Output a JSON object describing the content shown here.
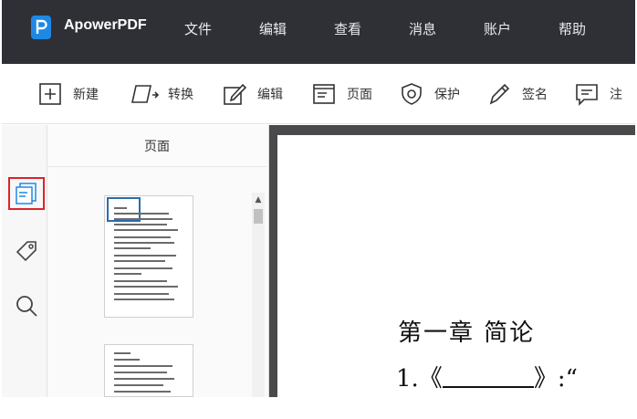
{
  "app": {
    "name": "ApowerPDF"
  },
  "menu": [
    "文件",
    "编辑",
    "查看",
    "消息",
    "账户",
    "帮助"
  ],
  "toolbar": [
    {
      "label": "新建",
      "icon": "plus-box-icon"
    },
    {
      "label": "转换",
      "icon": "convert-icon"
    },
    {
      "label": "编辑",
      "icon": "edit-pen-icon"
    },
    {
      "label": "页面",
      "icon": "page-icon"
    },
    {
      "label": "保护",
      "icon": "shield-icon"
    },
    {
      "label": "签名",
      "icon": "signature-pen-icon"
    },
    {
      "label": "注",
      "icon": "comment-icon"
    }
  ],
  "sidebar": {
    "rail": [
      {
        "icon": "pages-icon",
        "active": true
      },
      {
        "icon": "tag-icon",
        "active": false
      },
      {
        "icon": "search-icon",
        "active": false
      }
    ],
    "panel_title": "页面"
  },
  "document": {
    "heading": "第一章  简论",
    "line_prefix": "1.《",
    "line_suffix": "》:“"
  },
  "colors": {
    "titlebar_bg": "#2e3035",
    "logo_blue": "#1e88e5",
    "active_border": "#d9252a",
    "thumb_selection": "#2b6cb0",
    "doc_background": "#4a4a4c"
  }
}
